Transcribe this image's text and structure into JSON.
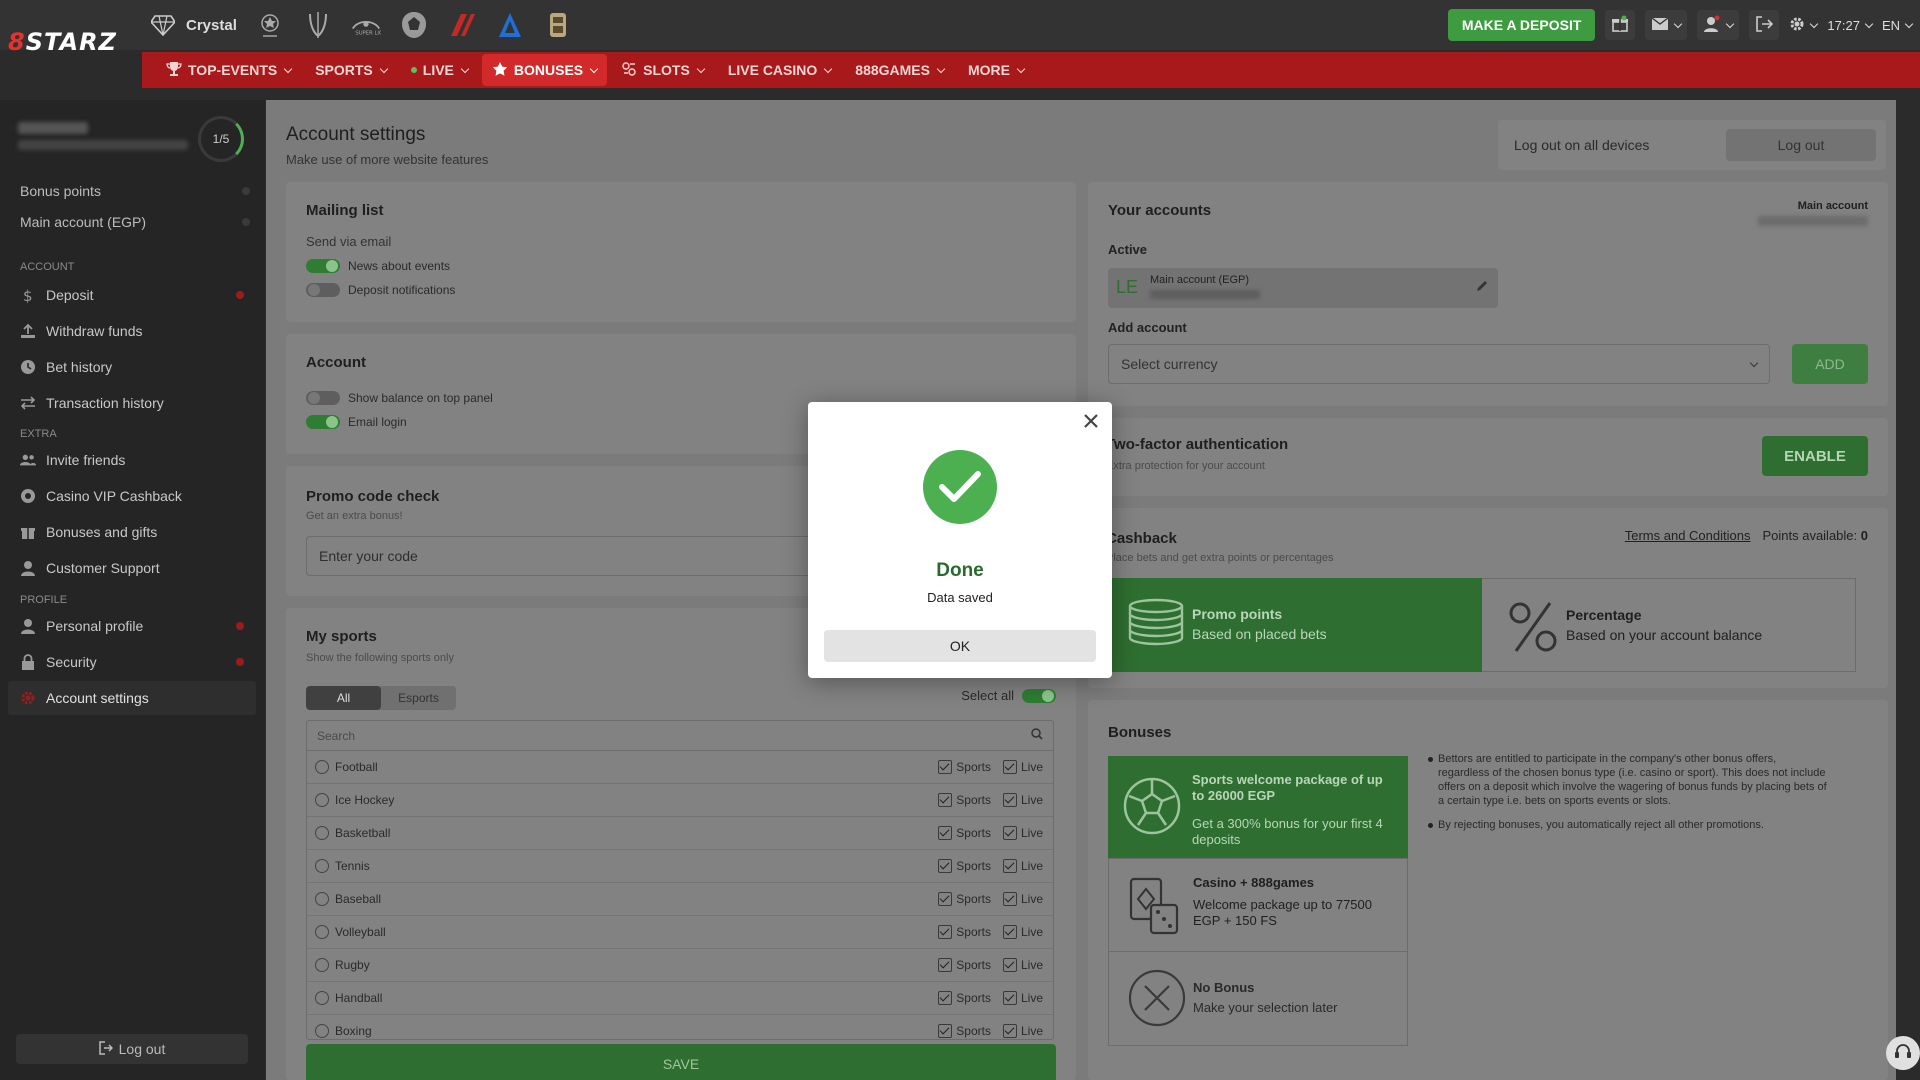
{
  "brand": {
    "logo_lead": "8",
    "logo_rest": "STARZ"
  },
  "partners": [
    {
      "name": "Crystal",
      "icon": "crystal-icon"
    },
    {
      "name": "",
      "icon": "champions-league-icon"
    },
    {
      "name": "",
      "icon": "europa-league-icon"
    },
    {
      "name": "",
      "icon": "club-logo-icon"
    },
    {
      "name": "",
      "icon": "lion-crest-icon"
    },
    {
      "name": "",
      "icon": "club-mark-icon"
    },
    {
      "name": "",
      "icon": "triangle-logo-icon"
    },
    {
      "name": "",
      "icon": "shield-crest-icon"
    }
  ],
  "topbar": {
    "deposit_label": "MAKE A DEPOSIT",
    "time": "17:27",
    "lang": "EN"
  },
  "nav": {
    "items": [
      {
        "label": "TOP-EVENTS",
        "icon": "trophy-icon"
      },
      {
        "label": "SPORTS",
        "icon": ""
      },
      {
        "label": "LIVE",
        "icon": "live-dot"
      },
      {
        "label": "BONUSES",
        "icon": "star-icon",
        "active": true
      },
      {
        "label": "SLOTS",
        "icon": "slot-icon"
      },
      {
        "label": "LIVE CASINO",
        "icon": ""
      },
      {
        "label": "888GAMES",
        "icon": ""
      },
      {
        "label": "MORE",
        "icon": ""
      }
    ]
  },
  "sidebar": {
    "progress": "1/5",
    "balances": [
      "Bonus points",
      "Main account (EGP)"
    ],
    "sections": {
      "account": "ACCOUNT",
      "extra": "EXTRA",
      "profile": "PROFILE"
    },
    "account_items": [
      "Deposit",
      "Withdraw funds",
      "Bet history",
      "Transaction history"
    ],
    "extra_items": [
      "Invite friends",
      "Casino VIP Cashback",
      "Bonuses and gifts",
      "Customer Support"
    ],
    "profile_items": [
      "Personal profile",
      "Security",
      "Account settings"
    ],
    "logout": "Log out"
  },
  "page": {
    "title": "Account settings",
    "subtitle": "Make use of more website features",
    "logout_all": "Log out on all devices",
    "logout_btn": "Log out"
  },
  "mailing": {
    "title": "Mailing list",
    "sub": "Send via email",
    "toggles": [
      {
        "label": "News about events",
        "on": true
      },
      {
        "label": "Deposit notifications",
        "on": false
      }
    ]
  },
  "account": {
    "title": "Account",
    "toggles": [
      {
        "label": "Show balance on top panel",
        "on": false
      },
      {
        "label": "Email login",
        "on": true
      }
    ]
  },
  "promo": {
    "title": "Promo code check",
    "sub": "Get an extra bonus!",
    "placeholder": "Enter your code"
  },
  "sports": {
    "title": "My sports",
    "sub": "Show the following sports only",
    "tabs": [
      "All",
      "Esports"
    ],
    "select_all": "Select all",
    "search": "Search",
    "col_sports": "Sports",
    "col_live": "Live",
    "rows": [
      "Football",
      "Ice Hockey",
      "Basketball",
      "Tennis",
      "Baseball",
      "Volleyball",
      "Rugby",
      "Handball",
      "Boxing"
    ],
    "save": "SAVE"
  },
  "your_accounts": {
    "title": "Your accounts",
    "main_label": "Main account",
    "active": "Active",
    "currency_symbol": "LE",
    "active_account": "Main account (EGP)",
    "add_account": "Add account",
    "select_currency": "Select currency",
    "add_btn": "ADD"
  },
  "twofa": {
    "title": "Two-factor authentication",
    "sub": "Extra protection for your account",
    "btn": "ENABLE"
  },
  "cashback": {
    "title": "Cashback",
    "sub": "Place bets and get extra points or percentages",
    "terms": "Terms and Conditions",
    "points_label": "Points available:",
    "points": "0",
    "tiles": [
      {
        "title": "Promo points",
        "sub": "Based on placed bets"
      },
      {
        "title": "Percentage",
        "sub": "Based on your account balance"
      }
    ]
  },
  "bonuses": {
    "title": "Bonuses",
    "tiles": [
      {
        "title": "Sports welcome package of up to 26000 EGP",
        "sub": "Get a 300% bonus for your first 4 deposits"
      },
      {
        "title": "Casino + 888games",
        "sub": "Welcome package up to 77500 EGP + 150 FS"
      },
      {
        "title": "No Bonus",
        "sub": "Make your selection later"
      }
    ],
    "notes": [
      "Bettors are entitled to participate in the company's other bonus offers, regardless of the chosen bonus type (i.e. casino or sport). This does not include offers on a deposit which involve the wagering of bonus funds by placing bets of a certain type i.e. bets on sports events or slots.",
      "By rejecting bonuses, you automatically reject all other promotions."
    ]
  },
  "modal": {
    "title": "Done",
    "message": "Data saved",
    "ok": "OK"
  },
  "colors": {
    "brand_red": "#a8191b",
    "accent_green": "#4caf50",
    "deposit_green": "#3f9b3f"
  }
}
